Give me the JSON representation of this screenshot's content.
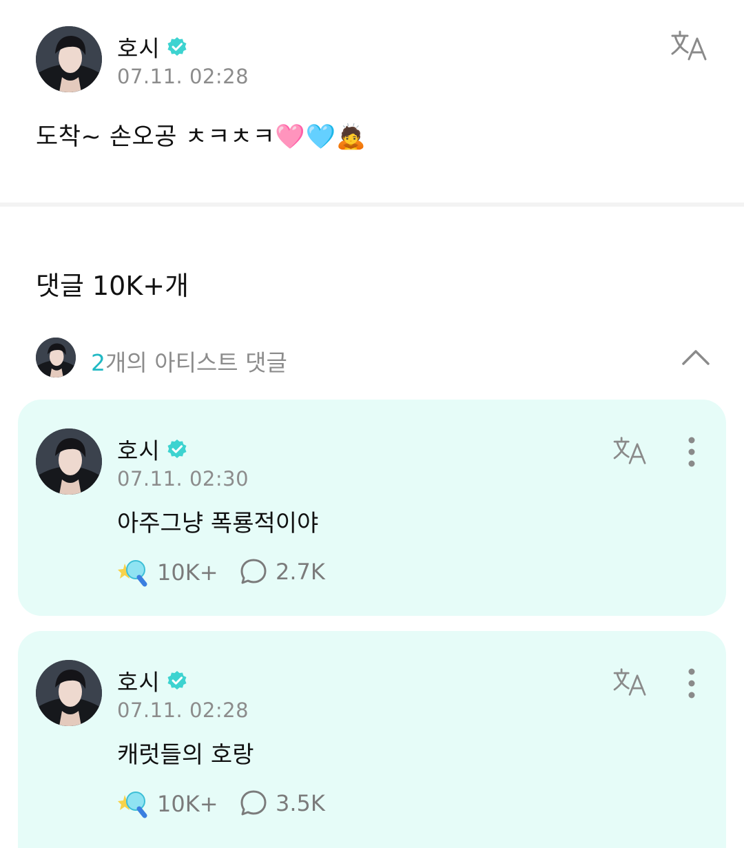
{
  "post": {
    "author": "호시",
    "timestamp": "07.11. 02:28",
    "text": "도착~ 손오공 ㅊㅋㅊㅋ🩷🩵🙇"
  },
  "comments_header": {
    "label": "댓글 10K+개"
  },
  "artist_comments": {
    "count": "2",
    "label": "개의 아티스트 댓글"
  },
  "comments": [
    {
      "author": "호시",
      "timestamp": "07.11. 02:30",
      "text": "아주그냥 폭룡적이야",
      "likes": "10K+",
      "replies": "2.7K"
    },
    {
      "author": "호시",
      "timestamp": "07.11. 02:28",
      "text": "캐럿들의 호랑",
      "likes": "10K+",
      "replies": "3.5K"
    }
  ],
  "colors": {
    "accent": "#21b9c4",
    "verified": "#3dd3d0",
    "card_bg": "#e6fcf8"
  },
  "icons": [
    "verified-badge-icon",
    "translate-icon",
    "chevron-up-icon",
    "more-vertical-icon",
    "lightstick-icon",
    "comment-bubble-icon"
  ]
}
